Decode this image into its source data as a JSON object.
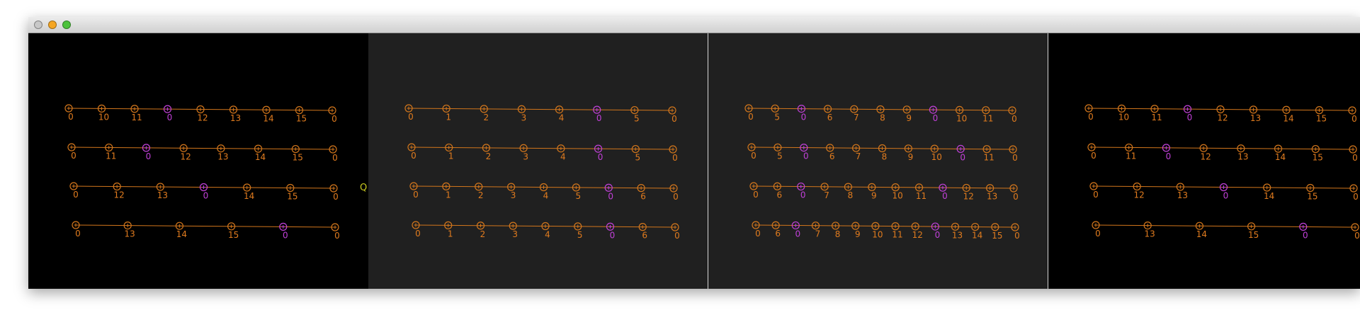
{
  "window": {
    "traffic_lights": [
      {
        "name": "close-button",
        "color": "#c8c8c8"
      },
      {
        "name": "minimize-button",
        "color": "#f5a623"
      },
      {
        "name": "zoom-button",
        "color": "#4cc23b"
      }
    ]
  },
  "colors": {
    "line": "#d2761c",
    "label": "#e07b1e",
    "highlight": "#c040d8",
    "marker_q": "#c8c820",
    "panel_dark": "#000000",
    "panel_gray": "#202020",
    "divider": "#d8d8d8"
  },
  "q_label": "Q",
  "panels": [
    {
      "background": "panel_dark",
      "rows": [
        {
          "nodes": [
            {
              "l": "0"
            },
            {
              "l": "10"
            },
            {
              "l": "11"
            },
            {
              "l": "0",
              "h": true
            },
            {
              "l": "12"
            },
            {
              "l": "13"
            },
            {
              "l": "14"
            },
            {
              "l": "15"
            },
            {
              "l": "0"
            }
          ]
        },
        {
          "nodes": [
            {
              "l": "0"
            },
            {
              "l": "11"
            },
            {
              "l": "0",
              "h": true
            },
            {
              "l": "12"
            },
            {
              "l": "13"
            },
            {
              "l": "14"
            },
            {
              "l": "15"
            },
            {
              "l": "0"
            }
          ]
        },
        {
          "nodes": [
            {
              "l": "0"
            },
            {
              "l": "12"
            },
            {
              "l": "13"
            },
            {
              "l": "0",
              "h": true
            },
            {
              "l": "14"
            },
            {
              "l": "15"
            },
            {
              "l": "0"
            }
          ]
        },
        {
          "nodes": [
            {
              "l": "0"
            },
            {
              "l": "13"
            },
            {
              "l": "14"
            },
            {
              "l": "15"
            },
            {
              "l": "0",
              "h": true
            },
            {
              "l": "0"
            }
          ]
        }
      ]
    },
    {
      "background": "panel_gray",
      "rows": [
        {
          "nodes": [
            {
              "l": "0"
            },
            {
              "l": "1"
            },
            {
              "l": "2"
            },
            {
              "l": "3"
            },
            {
              "l": "4"
            },
            {
              "l": "0",
              "h": true
            },
            {
              "l": "5"
            },
            {
              "l": "0"
            }
          ]
        },
        {
          "nodes": [
            {
              "l": "0"
            },
            {
              "l": "1"
            },
            {
              "l": "2"
            },
            {
              "l": "3"
            },
            {
              "l": "4"
            },
            {
              "l": "0",
              "h": true
            },
            {
              "l": "5"
            },
            {
              "l": "0"
            }
          ]
        },
        {
          "nodes": [
            {
              "l": "0"
            },
            {
              "l": "1"
            },
            {
              "l": "2"
            },
            {
              "l": "3"
            },
            {
              "l": "4"
            },
            {
              "l": "5"
            },
            {
              "l": "0",
              "h": true
            },
            {
              "l": "6"
            },
            {
              "l": "0"
            }
          ]
        },
        {
          "nodes": [
            {
              "l": "0"
            },
            {
              "l": "1"
            },
            {
              "l": "2"
            },
            {
              "l": "3"
            },
            {
              "l": "4"
            },
            {
              "l": "5"
            },
            {
              "l": "0",
              "h": true
            },
            {
              "l": "6"
            },
            {
              "l": "0"
            }
          ]
        }
      ]
    },
    {
      "background": "panel_gray",
      "rows": [
        {
          "nodes": [
            {
              "l": "0"
            },
            {
              "l": "5"
            },
            {
              "l": "0",
              "h": true
            },
            {
              "l": "6"
            },
            {
              "l": "7"
            },
            {
              "l": "8"
            },
            {
              "l": "9"
            },
            {
              "l": "0",
              "h": true
            },
            {
              "l": "10"
            },
            {
              "l": "11"
            },
            {
              "l": "0"
            }
          ]
        },
        {
          "nodes": [
            {
              "l": "0"
            },
            {
              "l": "5"
            },
            {
              "l": "0",
              "h": true
            },
            {
              "l": "6"
            },
            {
              "l": "7"
            },
            {
              "l": "8"
            },
            {
              "l": "9"
            },
            {
              "l": "10"
            },
            {
              "l": "0",
              "h": true
            },
            {
              "l": "11"
            },
            {
              "l": "0"
            }
          ]
        },
        {
          "nodes": [
            {
              "l": "0"
            },
            {
              "l": "6"
            },
            {
              "l": "0",
              "h": true
            },
            {
              "l": "7"
            },
            {
              "l": "8"
            },
            {
              "l": "9"
            },
            {
              "l": "10"
            },
            {
              "l": "11"
            },
            {
              "l": "0",
              "h": true
            },
            {
              "l": "12"
            },
            {
              "l": "13"
            },
            {
              "l": "0"
            }
          ]
        },
        {
          "nodes": [
            {
              "l": "0"
            },
            {
              "l": "6"
            },
            {
              "l": "0",
              "h": true
            },
            {
              "l": "7"
            },
            {
              "l": "8"
            },
            {
              "l": "9"
            },
            {
              "l": "10"
            },
            {
              "l": "11"
            },
            {
              "l": "12"
            },
            {
              "l": "0",
              "h": true
            },
            {
              "l": "13"
            },
            {
              "l": "14"
            },
            {
              "l": "15"
            },
            {
              "l": "0"
            }
          ]
        }
      ]
    },
    {
      "background": "panel_dark",
      "rows": [
        {
          "nodes": [
            {
              "l": "0"
            },
            {
              "l": "10"
            },
            {
              "l": "11"
            },
            {
              "l": "0",
              "h": true
            },
            {
              "l": "12"
            },
            {
              "l": "13"
            },
            {
              "l": "14"
            },
            {
              "l": "15"
            },
            {
              "l": "0"
            }
          ]
        },
        {
          "nodes": [
            {
              "l": "0"
            },
            {
              "l": "11"
            },
            {
              "l": "0",
              "h": true
            },
            {
              "l": "12"
            },
            {
              "l": "13"
            },
            {
              "l": "14"
            },
            {
              "l": "15"
            },
            {
              "l": "0"
            }
          ]
        },
        {
          "nodes": [
            {
              "l": "0"
            },
            {
              "l": "12"
            },
            {
              "l": "13"
            },
            {
              "l": "0",
              "h": true
            },
            {
              "l": "14"
            },
            {
              "l": "15"
            },
            {
              "l": "0"
            }
          ]
        },
        {
          "nodes": [
            {
              "l": "0"
            },
            {
              "l": "13"
            },
            {
              "l": "14"
            },
            {
              "l": "15"
            },
            {
              "l": "0",
              "h": true
            },
            {
              "l": "0"
            }
          ]
        }
      ]
    }
  ]
}
